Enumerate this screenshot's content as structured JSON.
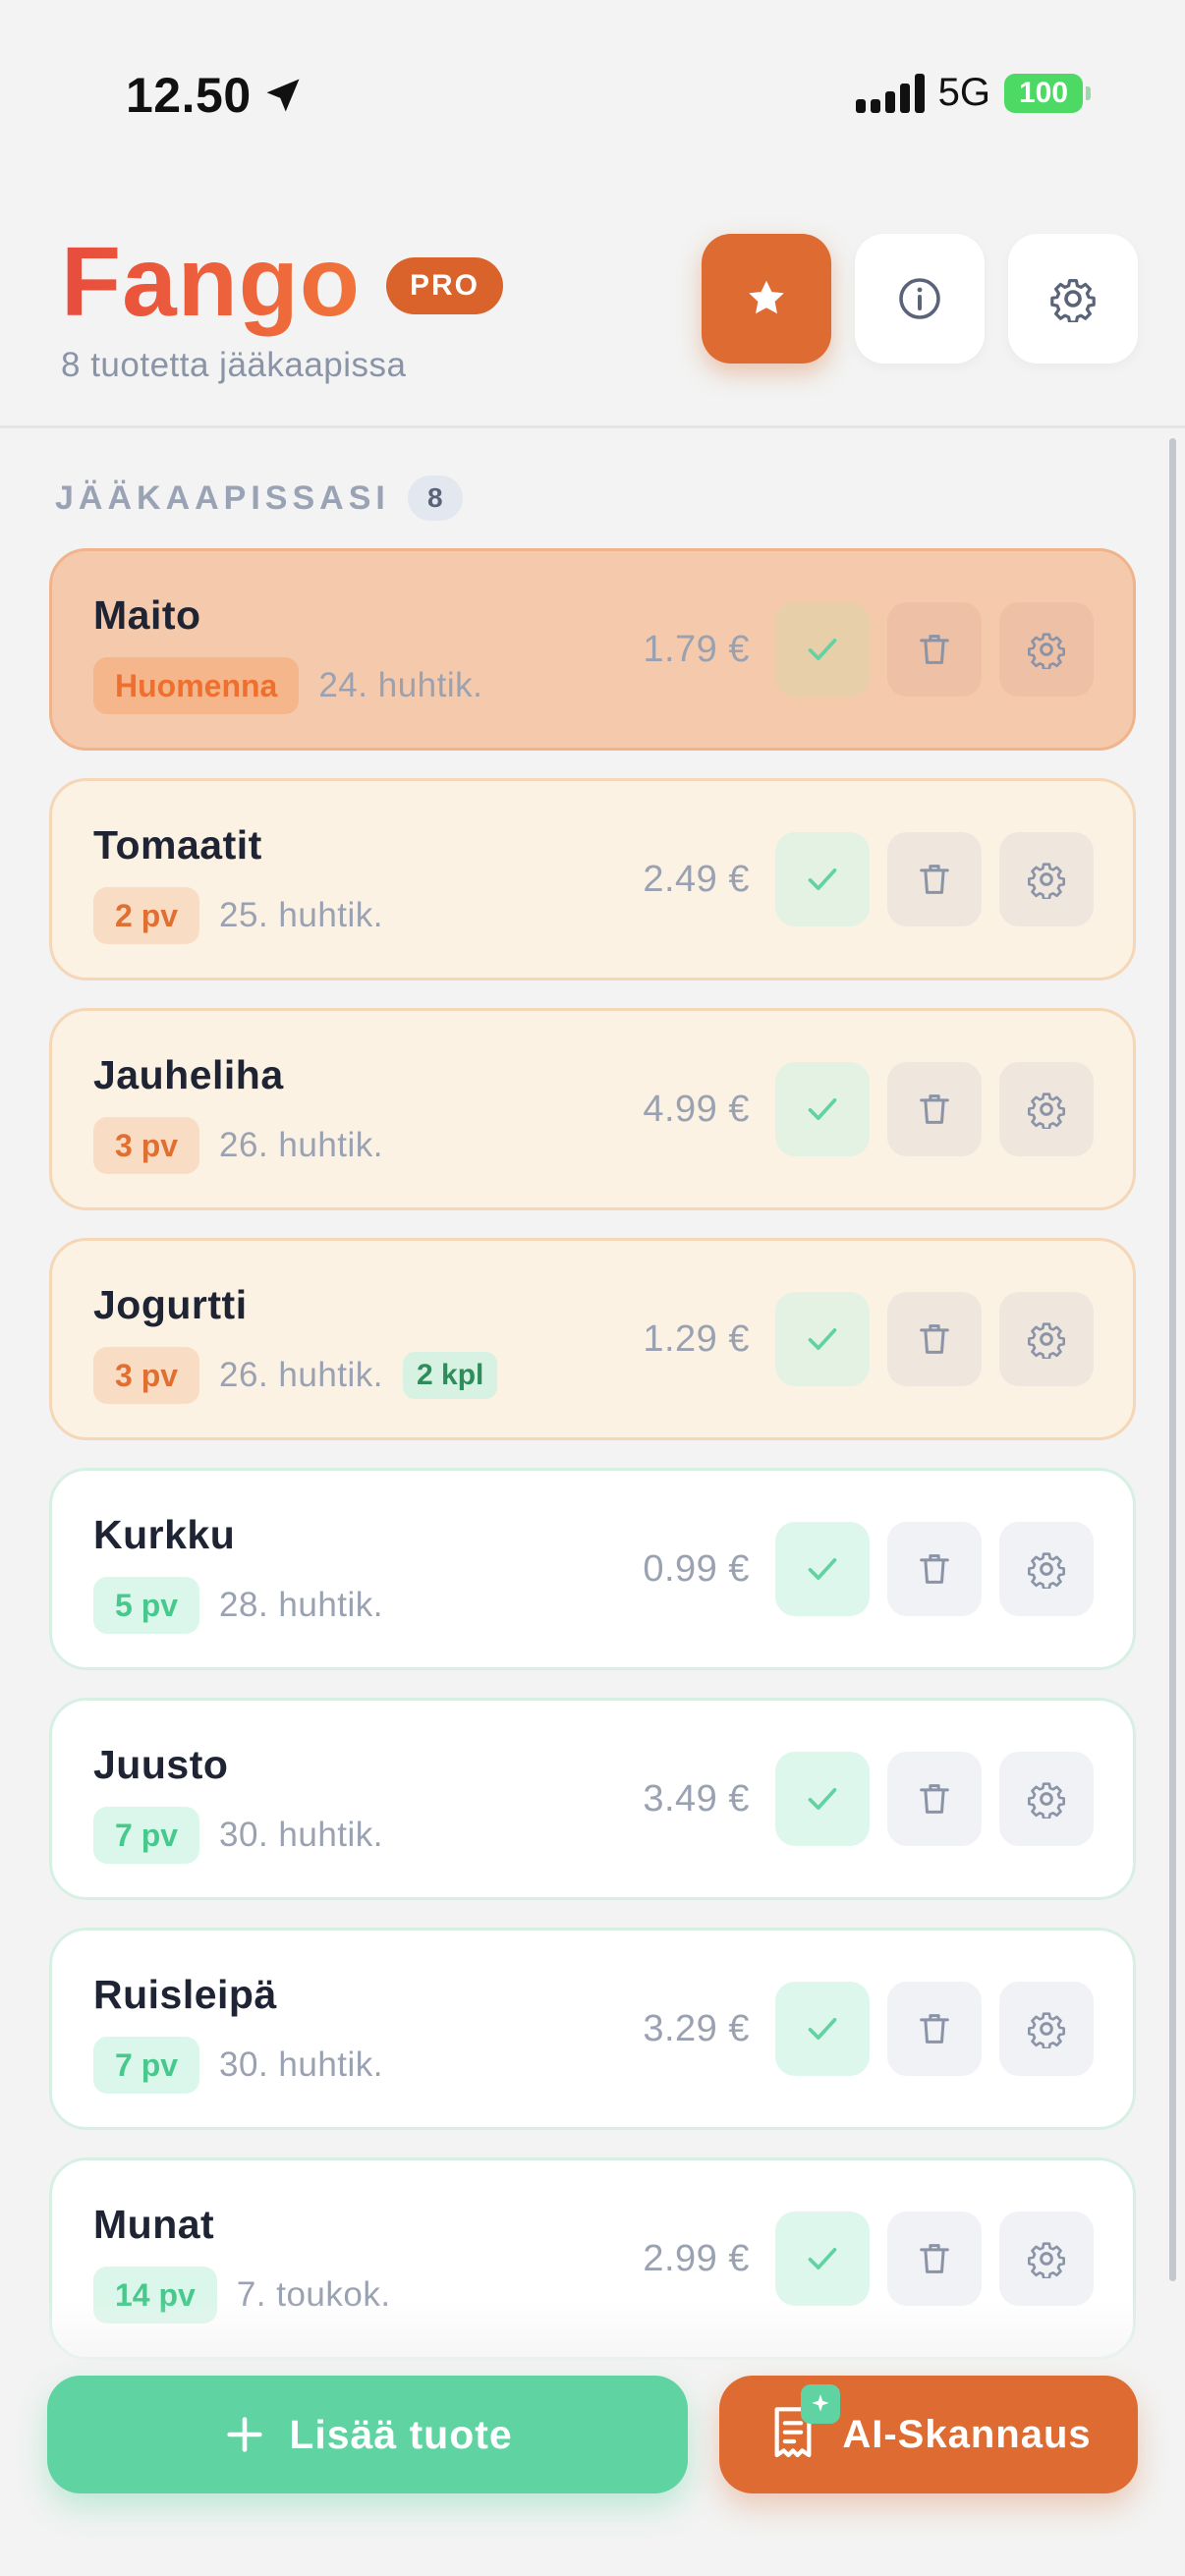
{
  "status_bar": {
    "time": "12.50",
    "network": "5G",
    "battery": "100"
  },
  "header": {
    "title": "Fango",
    "badge": "PRO",
    "subtitle": "8 tuotetta jääkaapissa",
    "icons": [
      "star-icon",
      "info-icon",
      "gear-icon"
    ]
  },
  "section": {
    "title": "JÄÄKAAPISSASI",
    "count": "8"
  },
  "items": [
    {
      "name": "Maito",
      "days": "Huomenna",
      "date": "24. huhtik.",
      "qty": "",
      "price": "1.79 €",
      "status": "urgent"
    },
    {
      "name": "Tomaatit",
      "days": "2 pv",
      "date": "25. huhtik.",
      "qty": "",
      "price": "2.49 €",
      "status": "soon"
    },
    {
      "name": "Jauheliha",
      "days": "3 pv",
      "date": "26. huhtik.",
      "qty": "",
      "price": "4.99 €",
      "status": "soon"
    },
    {
      "name": "Jogurtti",
      "days": "3 pv",
      "date": "26. huhtik.",
      "qty": "2 kpl",
      "price": "1.29 €",
      "status": "soon"
    },
    {
      "name": "Kurkku",
      "days": "5 pv",
      "date": "28. huhtik.",
      "qty": "",
      "price": "0.99 €",
      "status": "fresh"
    },
    {
      "name": "Juusto",
      "days": "7 pv",
      "date": "30. huhtik.",
      "qty": "",
      "price": "3.49 €",
      "status": "fresh"
    },
    {
      "name": "Ruisleipä",
      "days": "7 pv",
      "date": "30. huhtik.",
      "qty": "",
      "price": "3.29 €",
      "status": "fresh"
    },
    {
      "name": "Munat",
      "days": "14 pv",
      "date": "7. toukok.",
      "qty": "",
      "price": "2.99 €",
      "status": "fresh"
    }
  ],
  "actions": {
    "add_label": "Lisää tuote",
    "ai_label": "AI-Skannaus"
  },
  "colors": {
    "brand": "#de6b31",
    "accent_green": "#5fd4a2",
    "urgent_bg": "#f5c9ab",
    "soon_bg": "#fcf2e4"
  }
}
